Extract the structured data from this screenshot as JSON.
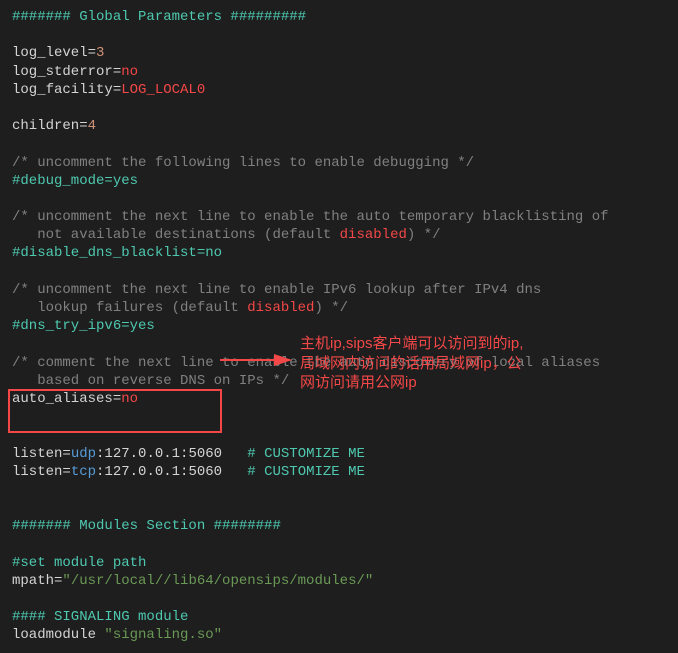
{
  "section1": {
    "header": "####### Global Parameters #########",
    "log_level_key": "log_level=",
    "log_level_val": "3",
    "log_stderror_key": "log_stderror=",
    "log_stderror_val": "no",
    "log_facility_key": "log_facility=",
    "log_facility_val": "LOG_LOCAL0",
    "children_key": "children=",
    "children_val": "4",
    "comment_debug": "/* uncomment the following lines to enable debugging */",
    "debug_mode": "#debug_mode=yes",
    "comment_blacklist1": "/* uncomment the next line to enable the auto temporary blacklisting of ",
    "comment_blacklist2_a": "   not available destinations (default ",
    "comment_blacklist2_b": "disabled",
    "comment_blacklist2_c": ") */",
    "disable_dns": "#disable_dns_blacklist=no",
    "comment_ipv6_1": "/* uncomment the next line to enable IPv6 lookup after IPv4 dns ",
    "comment_ipv6_2_a": "   lookup failures (default ",
    "comment_ipv6_2_b": "disabled",
    "comment_ipv6_2_c": ") */",
    "dns_try": "#dns_try_ipv6=yes",
    "comment_alias1": "/* comment the next line to enable the auto discovery of local aliases",
    "comment_alias2": "   based on reverse DNS on IPs */",
    "auto_aliases_key": "auto_aliases=",
    "auto_aliases_val": "no",
    "listen1_key": "listen=",
    "listen1_proto": "udp",
    "listen1_addr": ":127.0.0.1:5060",
    "listen2_key": "listen=",
    "listen2_proto": "tcp",
    "listen2_addr": ":127.0.0.1:5060",
    "customize1": "# CUSTOMIZE ME",
    "customize2": "# CUSTOMIZE ME"
  },
  "section2": {
    "header": "####### Modules Section ########",
    "set_module": "#set module path",
    "mpath_key": "mpath=",
    "mpath_val": "\"/usr/local//lib64/opensips/modules/\"",
    "sig_header": "#### SIGNALING module",
    "loadmodule_key": "loadmodule ",
    "loadmodule_val": "\"signaling.so\""
  },
  "annotation": {
    "line1": "主机ip,sips客户端可以访问到的ip,",
    "line2": "局域网内访问的话用局域网ip，公",
    "line3": "网访问请用公网ip"
  }
}
